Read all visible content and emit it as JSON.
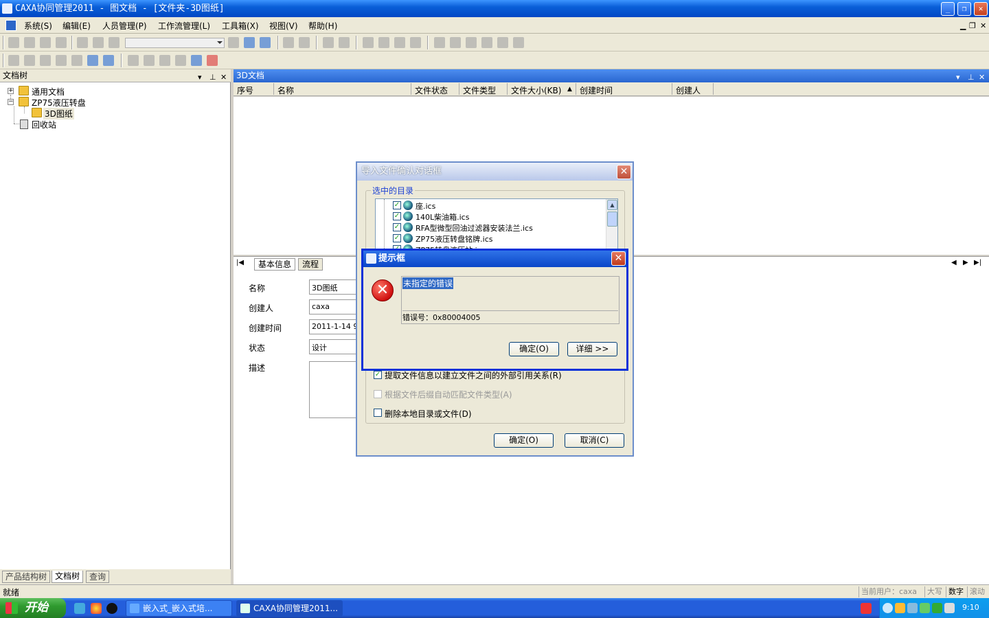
{
  "window": {
    "title": "CAXA协同管理2011 - 图文档 - [文件夹-3D图纸]"
  },
  "menu": [
    "系统(S)",
    "编辑(E)",
    "人员管理(P)",
    "工作流管理(L)",
    "工具箱(X)",
    "视图(V)",
    "帮助(H)"
  ],
  "left_panel": {
    "title": "文档树",
    "tree": [
      "通用文档",
      "ZP75液压转盘",
      "3D图纸",
      "回收站"
    ],
    "bottom_tabs": [
      "产品结构树",
      "文档树",
      "查询"
    ]
  },
  "right_panel": {
    "title": "3D文档",
    "columns": [
      "序号",
      "名称",
      "文件状态",
      "文件类型",
      "文件大小(KB)",
      "创建时间",
      "创建人"
    ],
    "detail_tabs": [
      "基本信息",
      "流程"
    ],
    "fields": [
      {
        "label": "名称",
        "value": "3D图纸"
      },
      {
        "label": "创建人",
        "value": "caxa"
      },
      {
        "label": "创建时间",
        "value": "2011-1-14 9"
      },
      {
        "label": "状态",
        "value": "设计"
      },
      {
        "label": "描述",
        "value": ""
      }
    ]
  },
  "import_dialog": {
    "title": "导入文件确认对话框",
    "group_label": "选中的目录",
    "files": [
      "座.ics",
      "140L柴油箱.ics",
      "RFA型微型回油过滤器安装法兰.ics",
      "ZP75液压转盘铭牌.ics",
      "ZP75转盘液压站.ics"
    ],
    "options": [
      {
        "label": "提取文件信息以建立文件之间的外部引用关系(R)",
        "checked": true,
        "enabled": true
      },
      {
        "label": "根据文件后缀自动匹配文件类型(A)",
        "checked": false,
        "enabled": false
      },
      {
        "label": "删除本地目录或文件(D)",
        "checked": false,
        "enabled": true
      }
    ],
    "ok": "确定(O)",
    "cancel": "取消(C)"
  },
  "alert_dialog": {
    "title": "提示框",
    "message": "未指定的错误",
    "error_code": "错误号：0x80004005",
    "ok": "确定(O)",
    "detail": "详细 >>"
  },
  "status": {
    "left": "就绪",
    "user": "当前用户：caxa",
    "caps": "大写",
    "num": "数字",
    "scroll": "滚动"
  },
  "taskbar": {
    "start": "开始",
    "tasks": [
      "嵌入式_嵌入式培...",
      "CAXA协同管理2011..."
    ],
    "clock": "9:10"
  }
}
